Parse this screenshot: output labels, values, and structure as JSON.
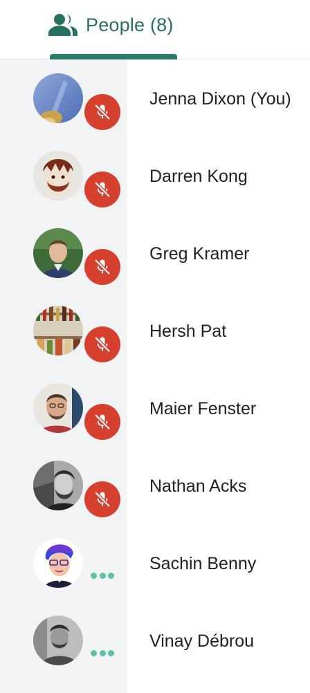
{
  "tab": {
    "icon": "people-icon",
    "label": "People (8)",
    "accent_color": "#2d7a68"
  },
  "participants": [
    {
      "name": "Jenna Dixon (You)",
      "status": "muted",
      "status_icon": "mic-off-icon"
    },
    {
      "name": "Darren Kong",
      "status": "muted",
      "status_icon": "mic-off-icon"
    },
    {
      "name": "Greg Kramer",
      "status": "muted",
      "status_icon": "mic-off-icon"
    },
    {
      "name": "Hersh Pat",
      "status": "muted",
      "status_icon": "mic-off-icon"
    },
    {
      "name": "Maier Fenster",
      "status": "muted",
      "status_icon": "mic-off-icon"
    },
    {
      "name": "Nathan Acks",
      "status": "muted",
      "status_icon": "mic-off-icon"
    },
    {
      "name": "Sachin Benny",
      "status": "connecting",
      "status_icon": "more-dots-icon"
    },
    {
      "name": "Vinay Débrou",
      "status": "connecting",
      "status_icon": "more-dots-icon"
    }
  ],
  "colors": {
    "muted_badge": "#d6402f",
    "connecting_dots": "#5cc0a6",
    "gutter": "#f1f3f4"
  }
}
